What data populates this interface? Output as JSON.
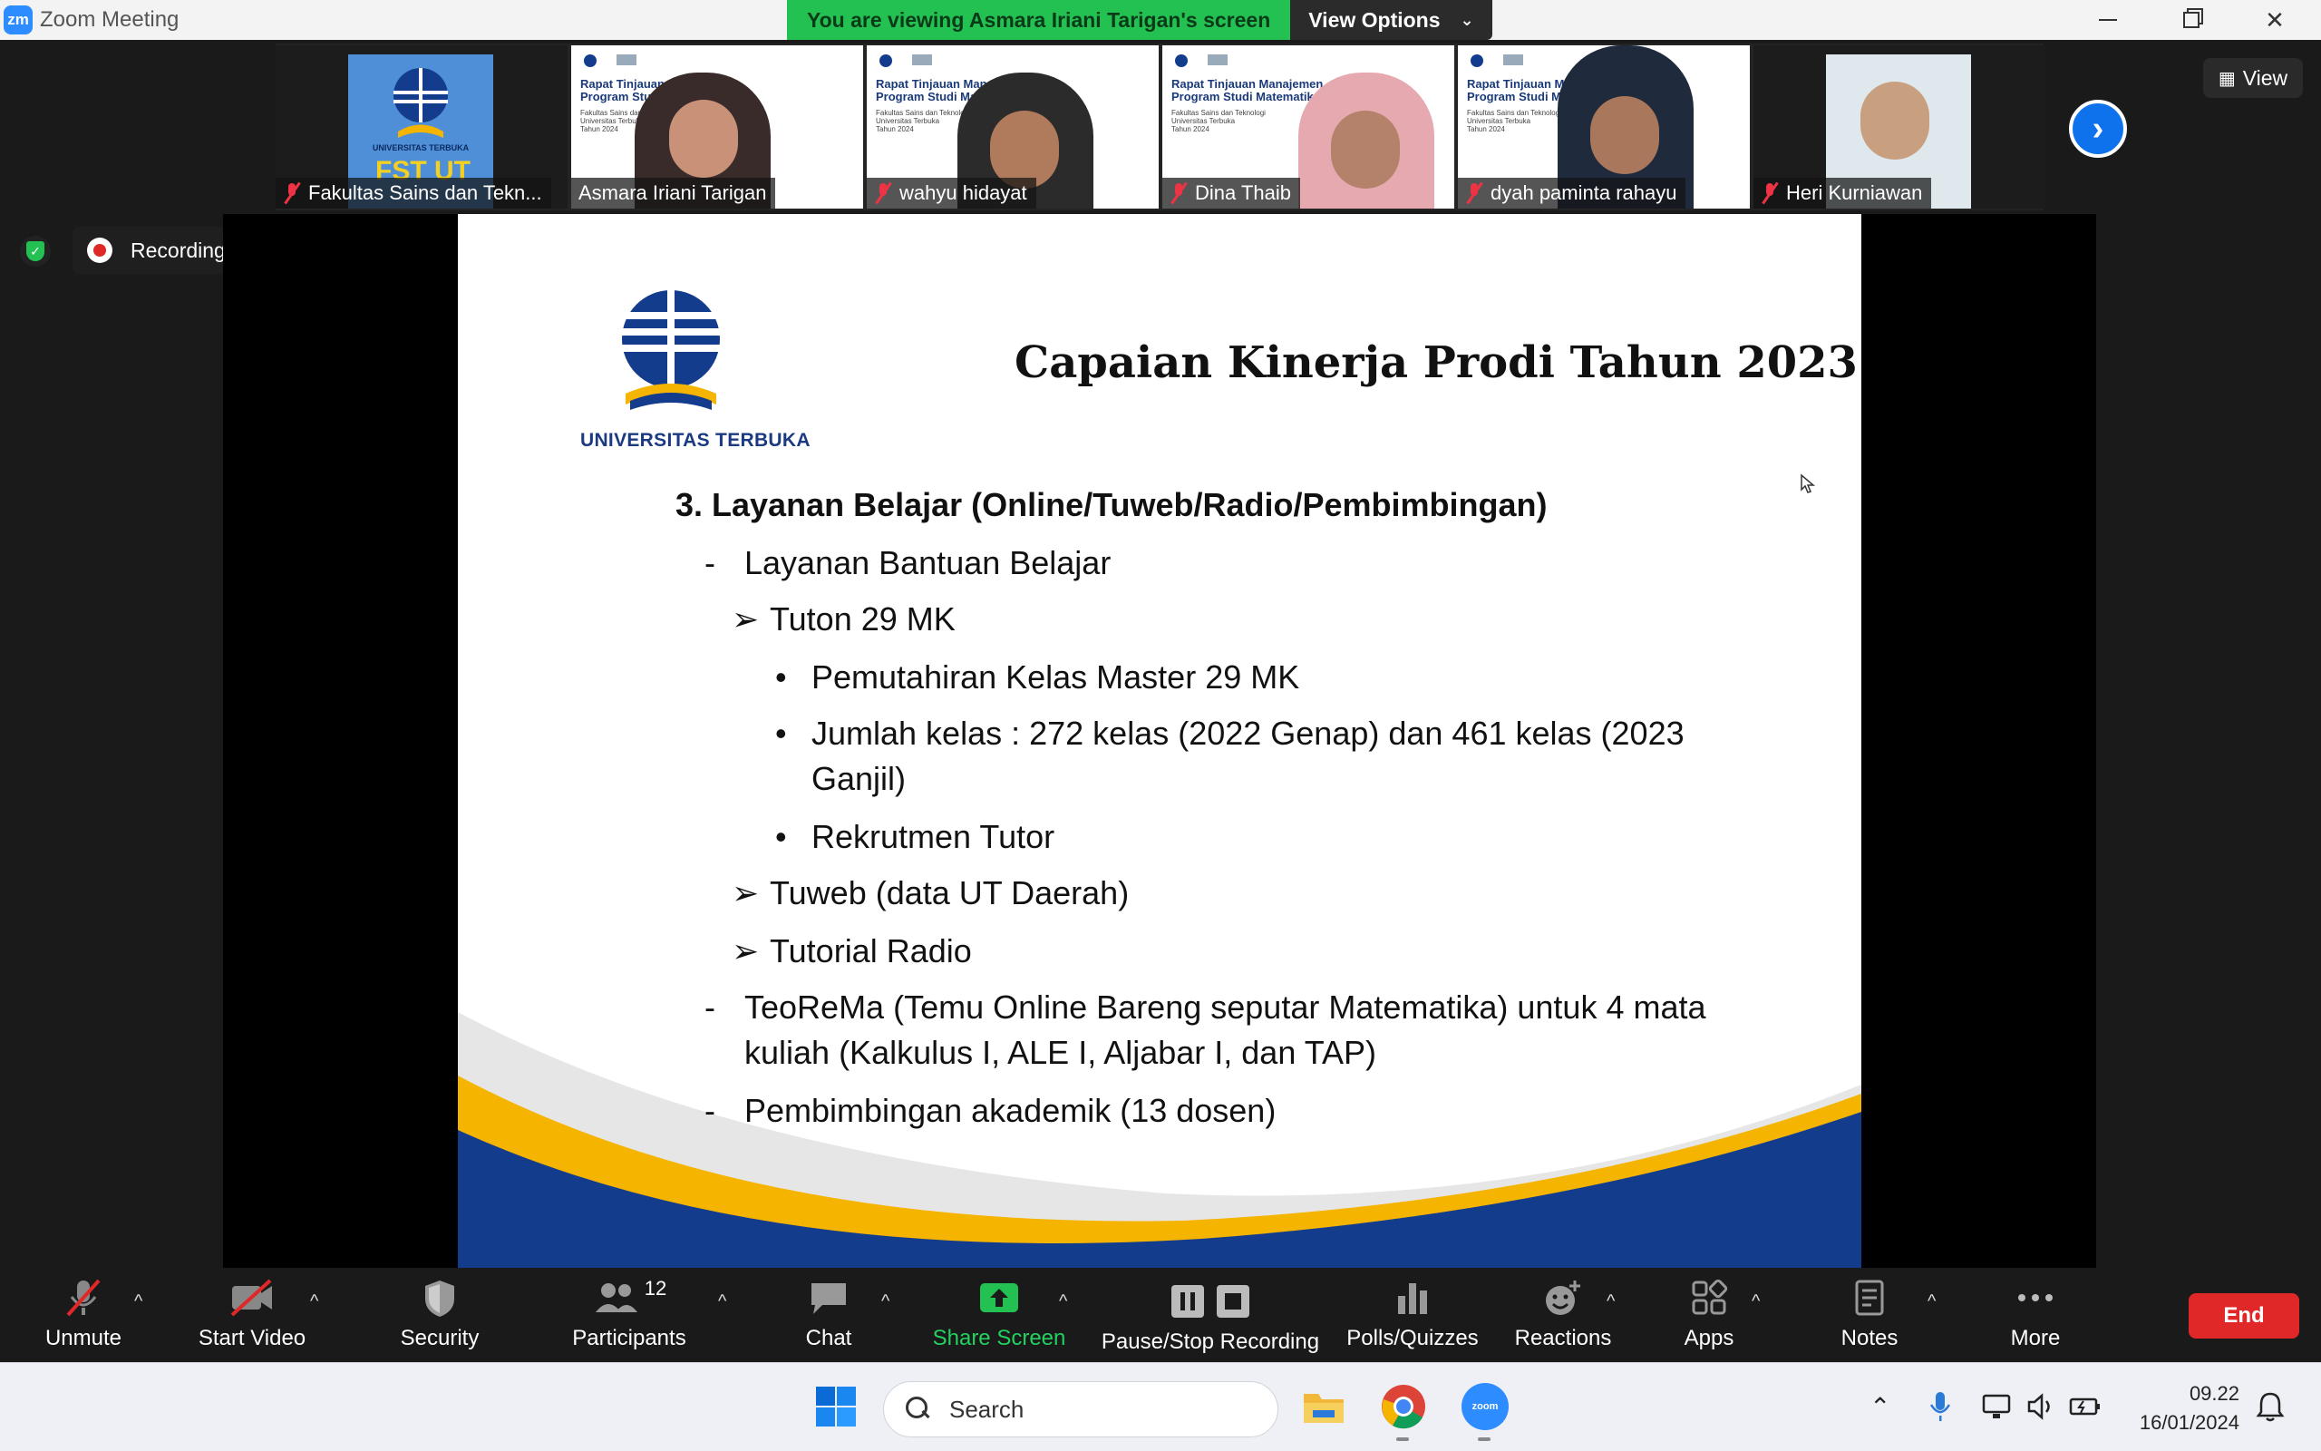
{
  "window": {
    "title": "Zoom Meeting",
    "logo_text": "zm"
  },
  "share_banner": {
    "message": "You are viewing Asmara Iriani Tarigan's screen",
    "options_label": "View Options"
  },
  "thumbnails": [
    {
      "name": "Fakultas Sains dan Tekn..."
    },
    {
      "name": "Asmara Iriani Tarigan"
    },
    {
      "name": "wahyu hidayat"
    },
    {
      "name": "Dina Thaib"
    },
    {
      "name": "dyah paminta rahayu"
    },
    {
      "name": "Heri Kurniawan"
    }
  ],
  "thumb_slide": {
    "title_line1": "Rapat Tinjauan Manajemen",
    "title_line2": "Program Studi Matematika",
    "sub_line1": "Fakultas Sains dan Teknologi",
    "sub_line2": "Universitas Terbuka",
    "sub_line3": "Tahun 2024"
  },
  "thumb0": {
    "caption": "UNIVERSITAS TERBUKA",
    "banner": "FST UT"
  },
  "view_button": {
    "label": "View"
  },
  "recording": {
    "label": "Recording..."
  },
  "slide": {
    "logo_caption": "UNIVERSITAS TERBUKA",
    "title": "Capaian Kinerja Prodi Tahun 2023",
    "heading": "3. Layanan Belajar (Online/Tuweb/Radio/Pembimbingan)",
    "dash1": "-",
    "item1": "Layanan Bantuan Belajar",
    "arrow": "➢",
    "sub1": "Tuton 29 MK",
    "bullet": "•",
    "b1": "Pemutahiran Kelas Master 29 MK",
    "b2_line1": "Jumlah  kelas  :  272  kelas  (2022  Genap)  dan  461  kelas  (2023",
    "b2_line2": "Ganjil)",
    "b3": "Rekrutmen Tutor",
    "sub2": "Tuweb (data UT Daerah)",
    "sub3": "Tutorial Radio",
    "item2_line1": "TeoReMa (Temu Online Bareng seputar Matematika) untuk 4 mata",
    "item2_line2": "kuliah (Kalkulus I, ALE I, Aljabar I, dan TAP)",
    "item3": "Pembimbingan akademik (13 dosen)"
  },
  "toolbar": {
    "unmute": "Unmute",
    "start_video": "Start Video",
    "security": "Security",
    "participants": "Participants",
    "participants_count": "12",
    "chat": "Chat",
    "share_screen": "Share Screen",
    "pause_stop": "Pause/Stop Recording",
    "polls": "Polls/Quizzes",
    "reactions": "Reactions",
    "apps": "Apps",
    "notes": "Notes",
    "more": "More",
    "end": "End",
    "caret": "^"
  },
  "taskbar": {
    "search_placeholder": "Search",
    "time": "09.22",
    "date": "16/01/2024",
    "zoom_label": "zoom"
  },
  "colors": {
    "zoom_blue": "#0e72ed",
    "share_green": "#23c151",
    "end_red": "#e02828",
    "ut_navy": "#143c8c",
    "ut_yellow": "#f5b400"
  }
}
